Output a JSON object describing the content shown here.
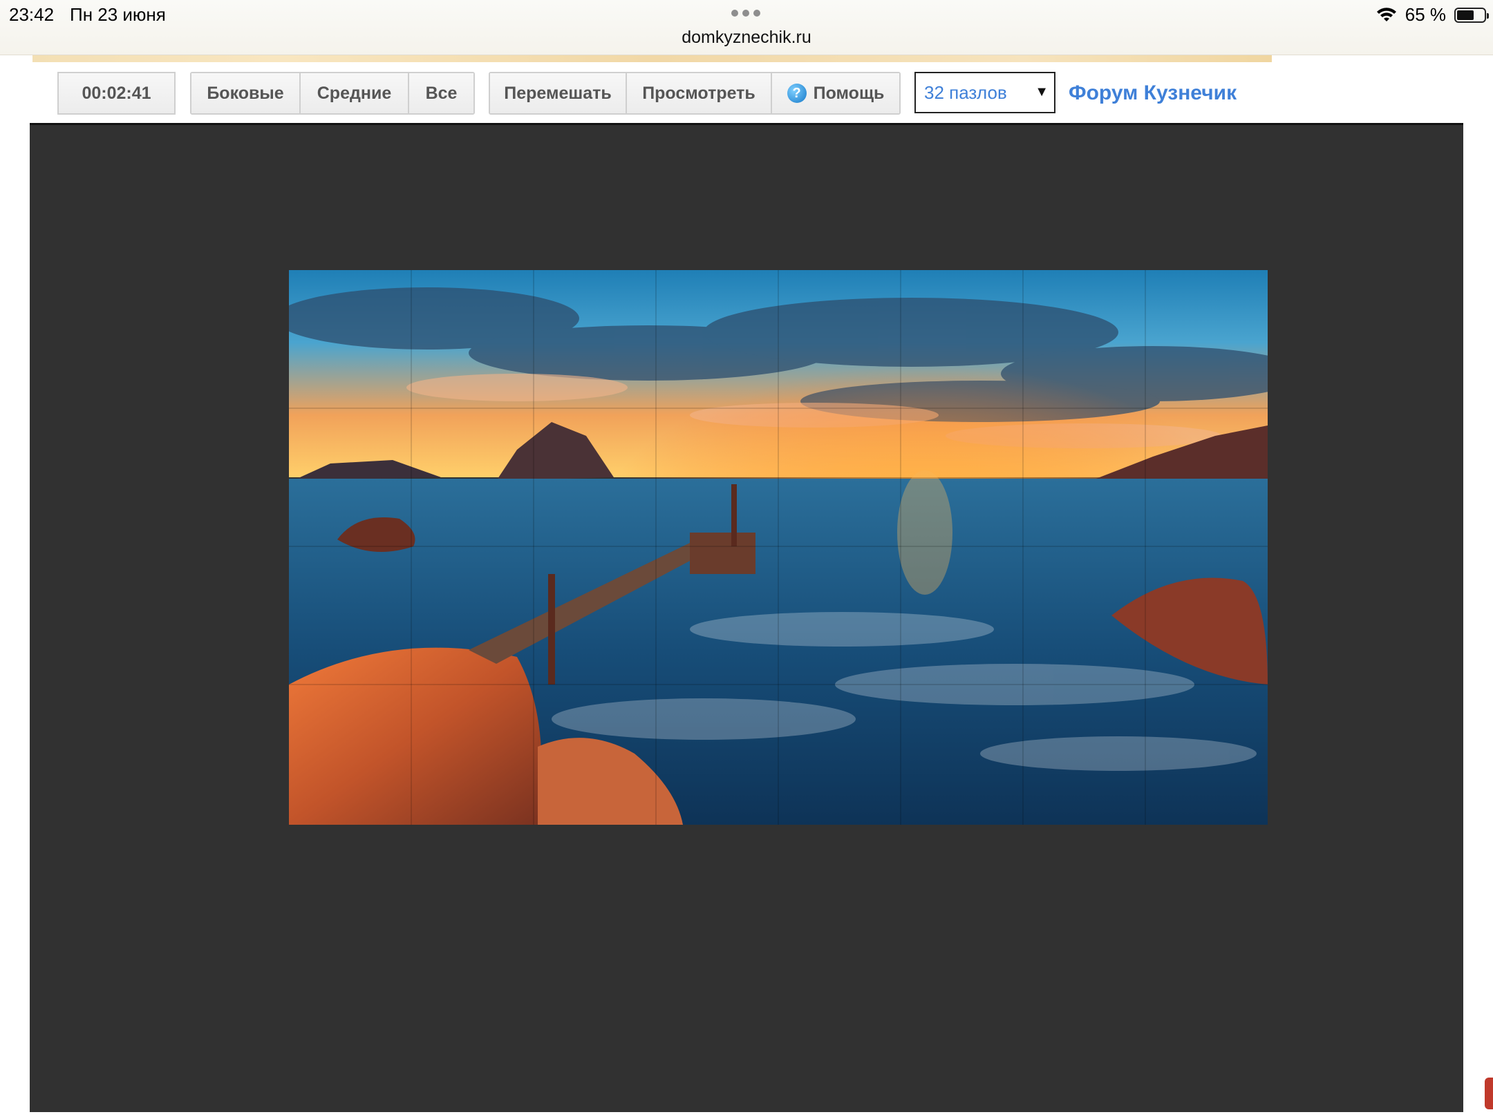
{
  "status_bar": {
    "time": "23:42",
    "date": "Пн 23 июня",
    "url": "domkyznechik.ru",
    "battery": "65 %",
    "battery_level": 0.65
  },
  "toolbar": {
    "timer": "00:02:41",
    "filter_buttons": [
      "Боковые",
      "Средние",
      "Все"
    ],
    "shuffle_label": "Перемешать",
    "preview_label": "Просмотреть",
    "help_icon_glyph": "?",
    "help_label": "Помощь",
    "pieces_select": "32 пазлов",
    "forum_link": "Форум Кузнечик"
  },
  "colors": {
    "link": "#3f80d8",
    "board_bg": "#313131"
  },
  "puzzle": {
    "image": "seascape-sunset-pier",
    "columns": 8,
    "rows": 4
  }
}
